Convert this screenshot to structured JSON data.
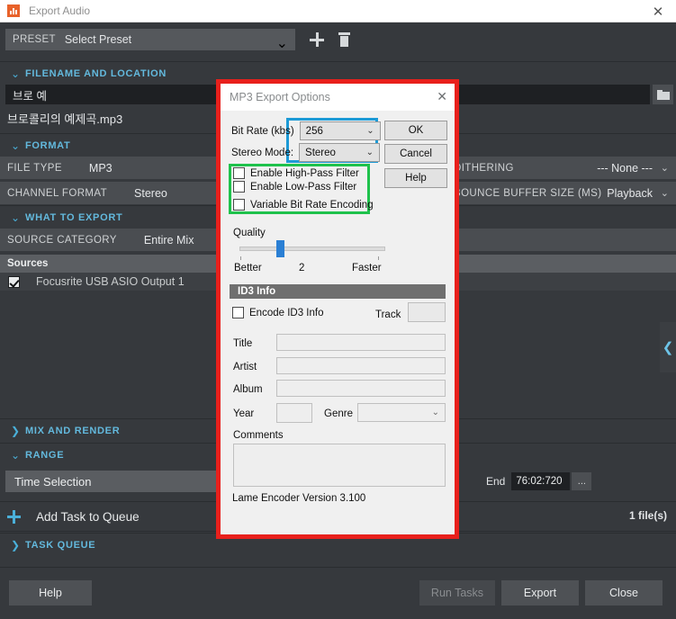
{
  "window": {
    "title": "Export Audio",
    "app_icon": "waveform-icon",
    "close_icon": "✕"
  },
  "preset": {
    "label": "PRESET",
    "value": "Select Preset",
    "caret": "⌄",
    "add_icon": "plus-icon",
    "delete_icon": "trash-icon"
  },
  "sections": {
    "filename_location": {
      "title": "FILENAME AND LOCATION",
      "chevron": "⌄"
    },
    "format": {
      "title": "FORMAT",
      "chevron": "⌄"
    },
    "what_to_export": {
      "title": "WHAT TO EXPORT",
      "chevron": "⌄"
    },
    "mix_and_render": {
      "title": "MIX AND RENDER",
      "chevron": "❯"
    },
    "range": {
      "title": "RANGE",
      "chevron": "⌄"
    },
    "task_queue": {
      "title": "TASK QUEUE",
      "chevron": "❯"
    }
  },
  "filename": {
    "path_value": "브로 예",
    "file_value": "브로콜리의 예제곡.mp3",
    "browse_icon": "folder-icon"
  },
  "format": {
    "file_type_label": "FILE TYPE",
    "file_type_value": "MP3",
    "channel_format_label": "CHANNEL FORMAT",
    "channel_format_value": "Stereo",
    "dithering_label": "DITHERING",
    "dithering_value": "--- None ---",
    "bounce_buffer_label": "BOUNCE BUFFER SIZE (MS)",
    "bounce_buffer_value": "Playback",
    "caret": "⌄"
  },
  "what_to_export": {
    "source_category_label": "SOURCE CATEGORY",
    "source_category_value": "Entire Mix",
    "sources_header": "Sources",
    "sources": [
      {
        "label": "Focusrite USB ASIO Output 1",
        "checked": true
      }
    ]
  },
  "range": {
    "selection_value": "Time Selection",
    "end_label": "End",
    "end_value": "76:02:720",
    "browse_label": "..."
  },
  "queue": {
    "add_task_label": "Add Task to Queue",
    "add_icon": "plus-icon",
    "file_count": "1 file(s)"
  },
  "footer": {
    "help_label": "Help",
    "run_tasks_label": "Run Tasks",
    "export_label": "Export",
    "close_label": "Close"
  },
  "edge": {
    "collapse_icon": "❮"
  },
  "modal": {
    "title": "MP3 Export Options",
    "close_icon": "✕",
    "bit_rate_label": "Bit Rate (kbs)",
    "bit_rate_value": "256",
    "stereo_mode_label": "Stereo Mode:",
    "stereo_mode_value": "Stereo",
    "caret": "⌄",
    "ok_label": "OK",
    "cancel_label": "Cancel",
    "help_label": "Help",
    "high_pass_label": "Enable High-Pass Filter",
    "low_pass_label": "Enable Low-Pass Filter",
    "vbr_label": "Variable Bit Rate Encoding",
    "quality_label": "Quality",
    "quality_better": "Better",
    "quality_value": "2",
    "quality_faster": "Faster",
    "id3_header": "ID3 Info",
    "encode_id3_label": "Encode ID3 Info",
    "track_label": "Track",
    "track_value": "",
    "title_label": "Title",
    "title_value": "",
    "artist_label": "Artist",
    "artist_value": "",
    "album_label": "Album",
    "album_value": "",
    "year_label": "Year",
    "year_value": "",
    "genre_label": "Genre",
    "genre_value": "",
    "comments_label": "Comments",
    "comments_value": "",
    "encoder_version": "Lame Encoder Version 3.100"
  },
  "highlights": {
    "outline_red": "#e8201c",
    "outline_blue": "#1c9ad6",
    "outline_green": "#1fc24c"
  }
}
